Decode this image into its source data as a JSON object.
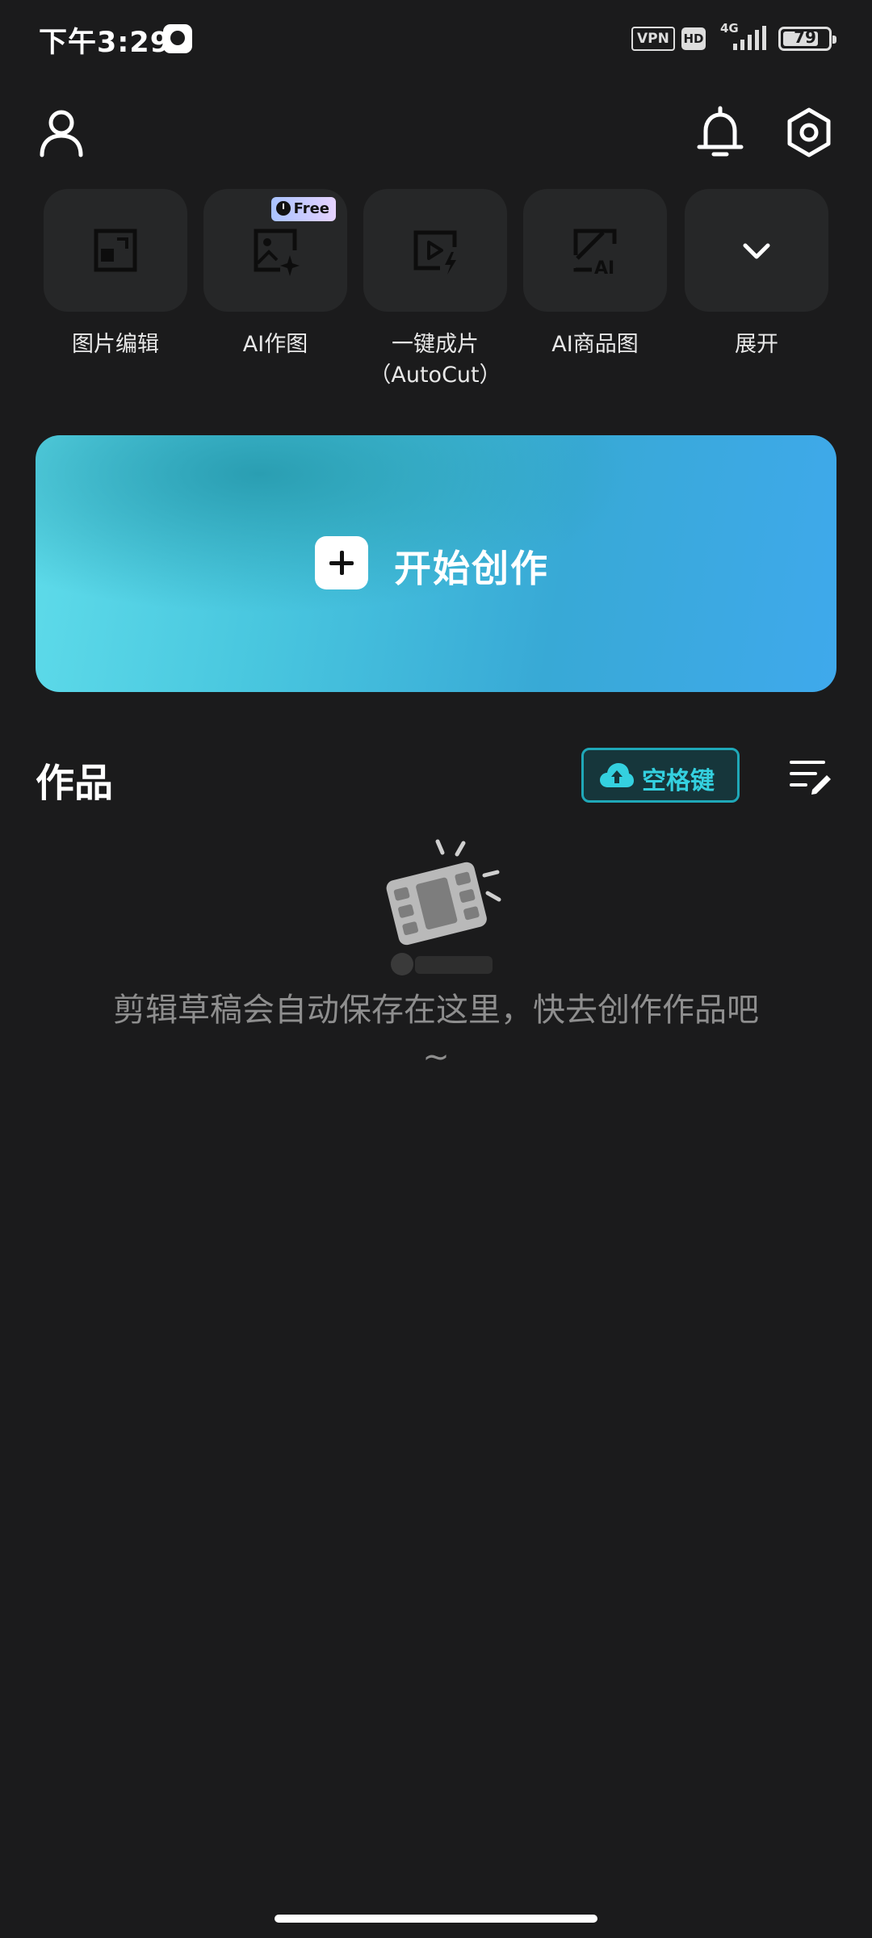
{
  "status_bar": {
    "time": "下午3:29",
    "vpn": "VPN",
    "hd": "HD",
    "network": "4G",
    "battery": "79",
    "battery_level": 0.79
  },
  "header": {
    "profile_icon": "user-icon",
    "notification_icon": "bell-icon",
    "settings_icon": "hexagon-gear-icon"
  },
  "tools": [
    {
      "label": "图片编辑",
      "icon": "photo-edit-icon"
    },
    {
      "label": "AI作图",
      "icon": "ai-image-icon",
      "badge": "Free"
    },
    {
      "label": "一键成片\n（AutoCut）",
      "icon": "autocut-icon"
    },
    {
      "label": "AI商品图",
      "icon": "ai-product-icon"
    },
    {
      "label": "展开",
      "icon": "chevron-down-icon"
    }
  ],
  "banner": {
    "label": "开始创作"
  },
  "works": {
    "title": "作品",
    "cloud_button": "空格键",
    "empty_message": "剪辑草稿会自动保存在这里，快去创作作品吧~"
  },
  "colors": {
    "background": "#1b1b1c",
    "tile": "#262728",
    "accent": "#34d0df",
    "banner_start": "#5fdcea",
    "banner_end": "#3fa9ec"
  }
}
